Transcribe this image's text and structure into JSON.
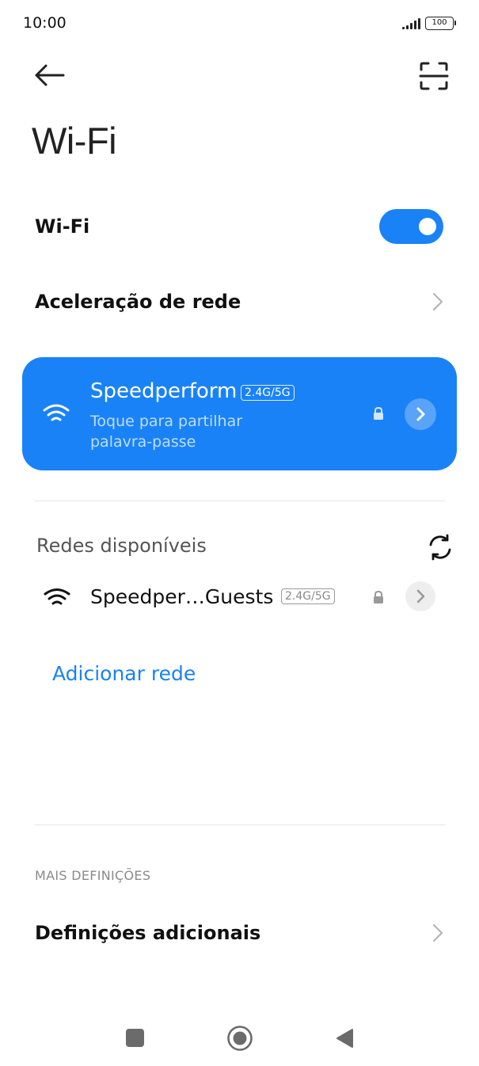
{
  "status_bar": {
    "time": "10:00",
    "battery": "100"
  },
  "header": {
    "title": "Wi-Fi"
  },
  "wifi_toggle": {
    "label": "Wi-Fi",
    "enabled": true
  },
  "network_acceleration": {
    "label": "Aceleração de rede"
  },
  "connected_network": {
    "ssid": "Speedperform",
    "band": "2.4G/5G",
    "subtitle_line1": "Toque para partilhar",
    "subtitle_line2": "palavra-passe"
  },
  "available_networks": {
    "title": "Redes disponíveis",
    "items": [
      {
        "ssid": "Speedper…Guests",
        "band": "2.4G/5G"
      }
    ]
  },
  "add_network": {
    "label": "Adicionar rede"
  },
  "more_settings": {
    "section_label": "MAIS DEFINIÇÕES",
    "items": [
      {
        "label": "Definições adicionais"
      }
    ]
  },
  "colors": {
    "accent": "#1a82f7"
  },
  "icons": {
    "back": "arrow-left-icon",
    "scan": "qr-scan-icon",
    "wifi": "wifi-icon",
    "lock": "lock-icon",
    "refresh": "refresh-icon"
  }
}
